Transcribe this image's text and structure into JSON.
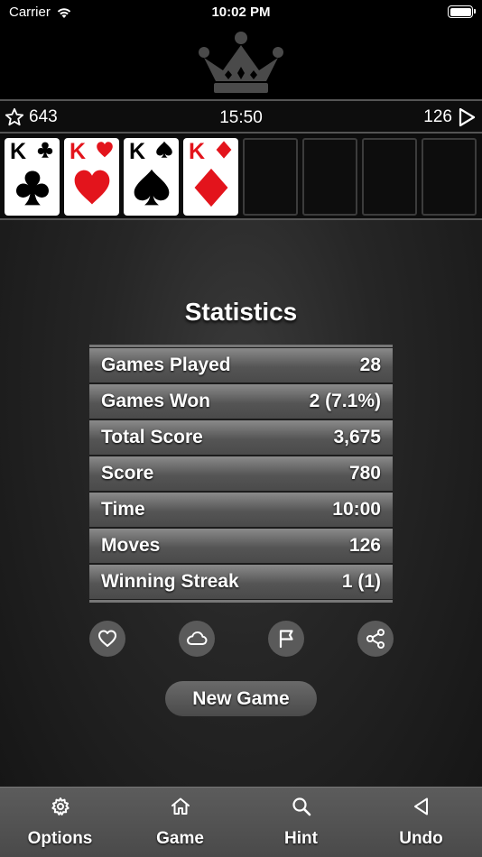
{
  "status_bar": {
    "carrier": "Carrier",
    "time": "10:02 PM"
  },
  "score_bar": {
    "stars": "643",
    "timer": "15:50",
    "moves": "126"
  },
  "foundation": [
    {
      "rank": "K",
      "suit": "clubs",
      "color": "black"
    },
    {
      "rank": "K",
      "suit": "hearts",
      "color": "red"
    },
    {
      "rank": "K",
      "suit": "spades",
      "color": "black"
    },
    {
      "rank": "K",
      "suit": "diamonds",
      "color": "red"
    }
  ],
  "statistics": {
    "title": "Statistics",
    "rows": [
      {
        "label": "Games Played",
        "value": "28"
      },
      {
        "label": "Games Won",
        "value": "2 (7.1%)"
      },
      {
        "label": "Total Score",
        "value": "3,675"
      },
      {
        "label": "Score",
        "value": "780"
      },
      {
        "label": "Time",
        "value": "10:00"
      },
      {
        "label": "Moves",
        "value": "126"
      },
      {
        "label": "Winning Streak",
        "value": "1 (1)"
      }
    ]
  },
  "actions": [
    "heart-icon",
    "cloud-icon",
    "flag-icon",
    "share-icon"
  ],
  "new_game_label": "New Game",
  "tabs": [
    {
      "label": "Options",
      "icon": "gear-icon"
    },
    {
      "label": "Game",
      "icon": "home-icon"
    },
    {
      "label": "Hint",
      "icon": "search-icon"
    },
    {
      "label": "Undo",
      "icon": "back-triangle-icon"
    }
  ],
  "colors": {
    "red_suit": "#e3141c",
    "button": "#5a5a5a",
    "tab_bar": "#555555"
  }
}
